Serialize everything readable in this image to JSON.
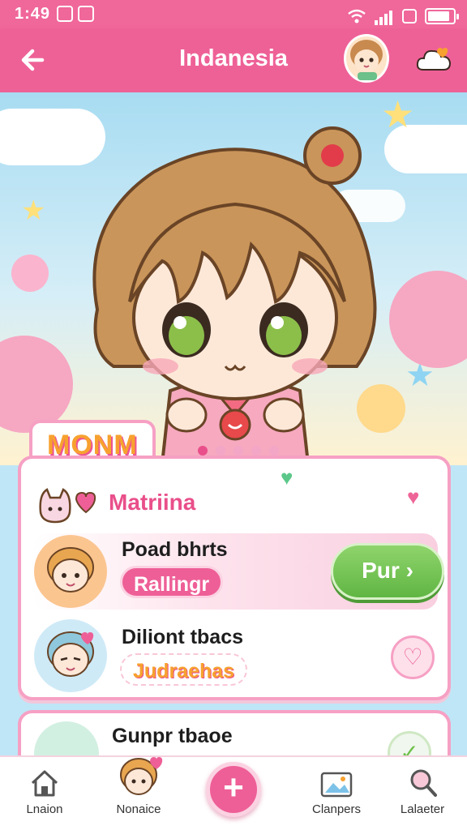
{
  "status_bar": {
    "time": "1:49",
    "icons": [
      "notification-icon",
      "notification-icon",
      "wifi-icon",
      "signal-icon",
      "battery-icon"
    ]
  },
  "header": {
    "title": "Indanesia",
    "back_icon": "arrow-left-icon",
    "avatar_icon": "chibi-avatar-icon",
    "cloud_icon": "cloud-heart-icon"
  },
  "hero": {
    "category_tag": "MONM",
    "carousel": {
      "count": 5,
      "active": 1
    }
  },
  "section": {
    "title": "Matriina",
    "items": [
      {
        "title": "Poad bhrts",
        "tag": "Rallingr",
        "action_label": "Pur",
        "action_icon": "chevron-right-icon"
      },
      {
        "title": "Diliont tbacs",
        "tag": "Judraehas",
        "action_icon": "heart-icon"
      },
      {
        "title": "Gunpr tbaoe"
      }
    ]
  },
  "bottom_nav": {
    "items": [
      {
        "label": "Lnaion",
        "icon": "home-icon"
      },
      {
        "label": "Nonaice",
        "icon": "chibi-avatar-icon"
      },
      {
        "label": "",
        "icon": "plus-icon"
      },
      {
        "label": "Clanpers",
        "icon": "gallery-icon"
      },
      {
        "label": "Lalaeter",
        "icon": "search-icon"
      }
    ]
  },
  "colors": {
    "primary_pink": "#ee6197",
    "accent_green": "#6cc04a",
    "accent_orange": "#f7a12f",
    "background_sky": "#bfe6f7"
  }
}
